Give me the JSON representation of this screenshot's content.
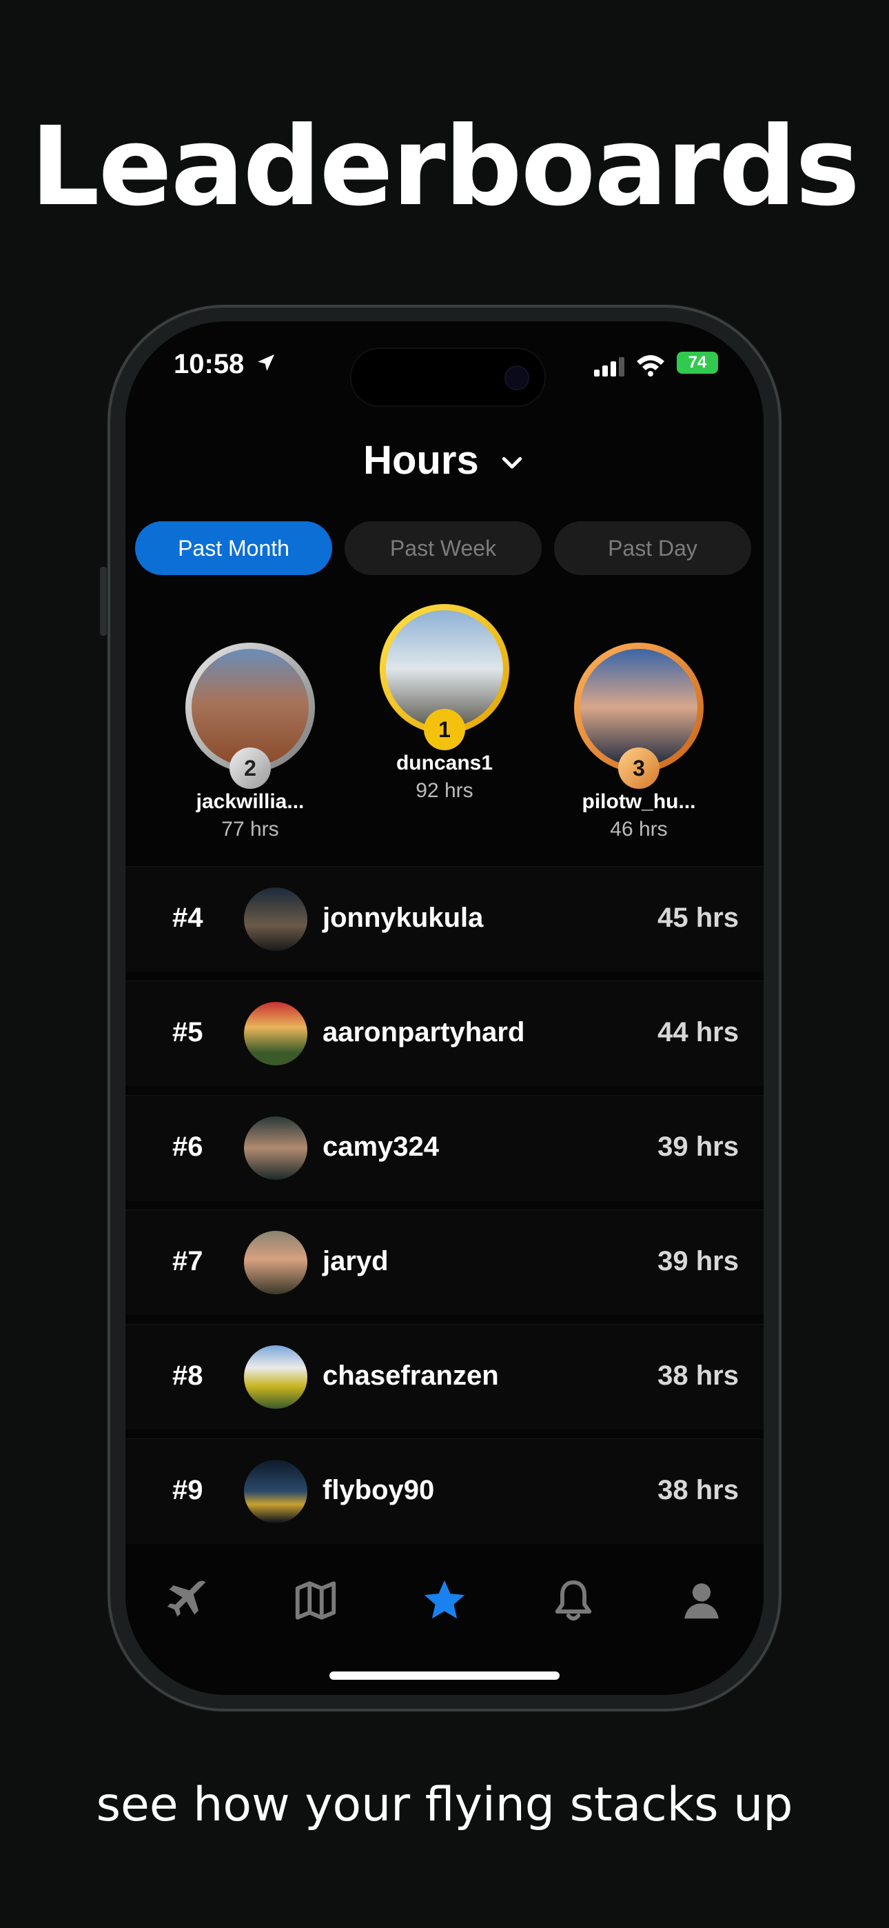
{
  "headline": "Leaderboards",
  "tagline": "see how your flying stacks up",
  "status": {
    "time": "10:58",
    "battery": "74"
  },
  "header": {
    "title": "Hours"
  },
  "periods": [
    {
      "label": "Past Month",
      "active": true
    },
    {
      "label": "Past Week",
      "active": false
    },
    {
      "label": "Past Day",
      "active": false
    }
  ],
  "podium": {
    "first": {
      "rank": "1",
      "name": "duncans1",
      "hours": "92 hrs"
    },
    "second": {
      "rank": "2",
      "name": "jackwillia...",
      "hours": "77 hrs"
    },
    "third": {
      "rank": "3",
      "name": "pilotw_hu...",
      "hours": "46 hrs"
    }
  },
  "rows": [
    {
      "rank": "#4",
      "name": "jonnykukula",
      "hours": "45 hrs"
    },
    {
      "rank": "#5",
      "name": "aaronpartyhard",
      "hours": "44 hrs"
    },
    {
      "rank": "#6",
      "name": "camy324",
      "hours": "39 hrs"
    },
    {
      "rank": "#7",
      "name": "jaryd",
      "hours": "39 hrs"
    },
    {
      "rank": "#8",
      "name": "chasefranzen",
      "hours": "38 hrs"
    },
    {
      "rank": "#9",
      "name": "flyboy90",
      "hours": "38 hrs"
    }
  ],
  "tabs": [
    {
      "icon": "plane-icon",
      "active": false
    },
    {
      "icon": "map-icon",
      "active": false
    },
    {
      "icon": "star-icon",
      "active": true
    },
    {
      "icon": "bell-icon",
      "active": false
    },
    {
      "icon": "profile-icon",
      "active": false
    }
  ],
  "colors": {
    "accent": "#0b6fd6",
    "gold": "#f4c20d",
    "silver": "#b8b8b8",
    "bronze": "#e8913a",
    "battery": "#31c94e"
  }
}
